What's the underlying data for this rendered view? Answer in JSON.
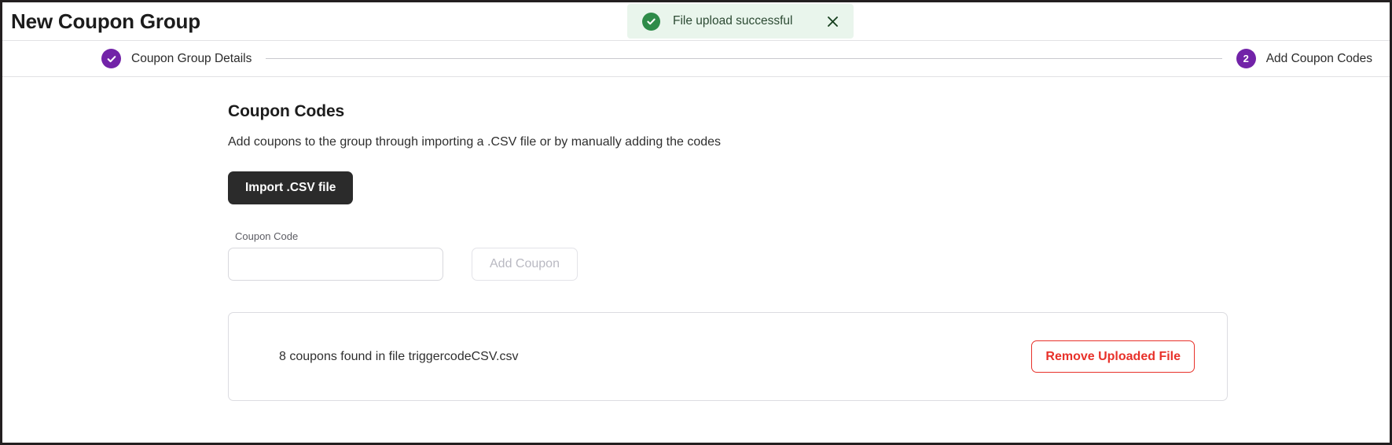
{
  "header": {
    "title": "New Coupon Group"
  },
  "toast": {
    "icon": "check-circle-icon",
    "message": "File upload successful",
    "close_icon": "close-icon",
    "background_color": "#E9F5EC",
    "icon_color": "#2E8B49",
    "text_color": "#2C4A33"
  },
  "stepper": {
    "accent_color": "#7223A8",
    "steps": [
      {
        "badge": "✓",
        "label": "Coupon Group Details",
        "state": "completed",
        "icon": "check-icon"
      },
      {
        "badge": "2",
        "label": "Add Coupon Codes",
        "state": "active",
        "icon": ""
      }
    ]
  },
  "main": {
    "title": "Coupon Codes",
    "description": "Add coupons to the group through importing a .CSV file or by manually adding the codes",
    "import_button": "Import .CSV file",
    "coupon_field": {
      "label": "Coupon Code",
      "value": "",
      "placeholder": ""
    },
    "add_coupon_button": "Add Coupon",
    "file_panel": {
      "info": "8 coupons found in file triggercodeCSV.csv",
      "coupon_count": 8,
      "file_name": "triggercodeCSV.csv",
      "remove_button": "Remove Uploaded File",
      "remove_color": "#E8312A"
    }
  }
}
